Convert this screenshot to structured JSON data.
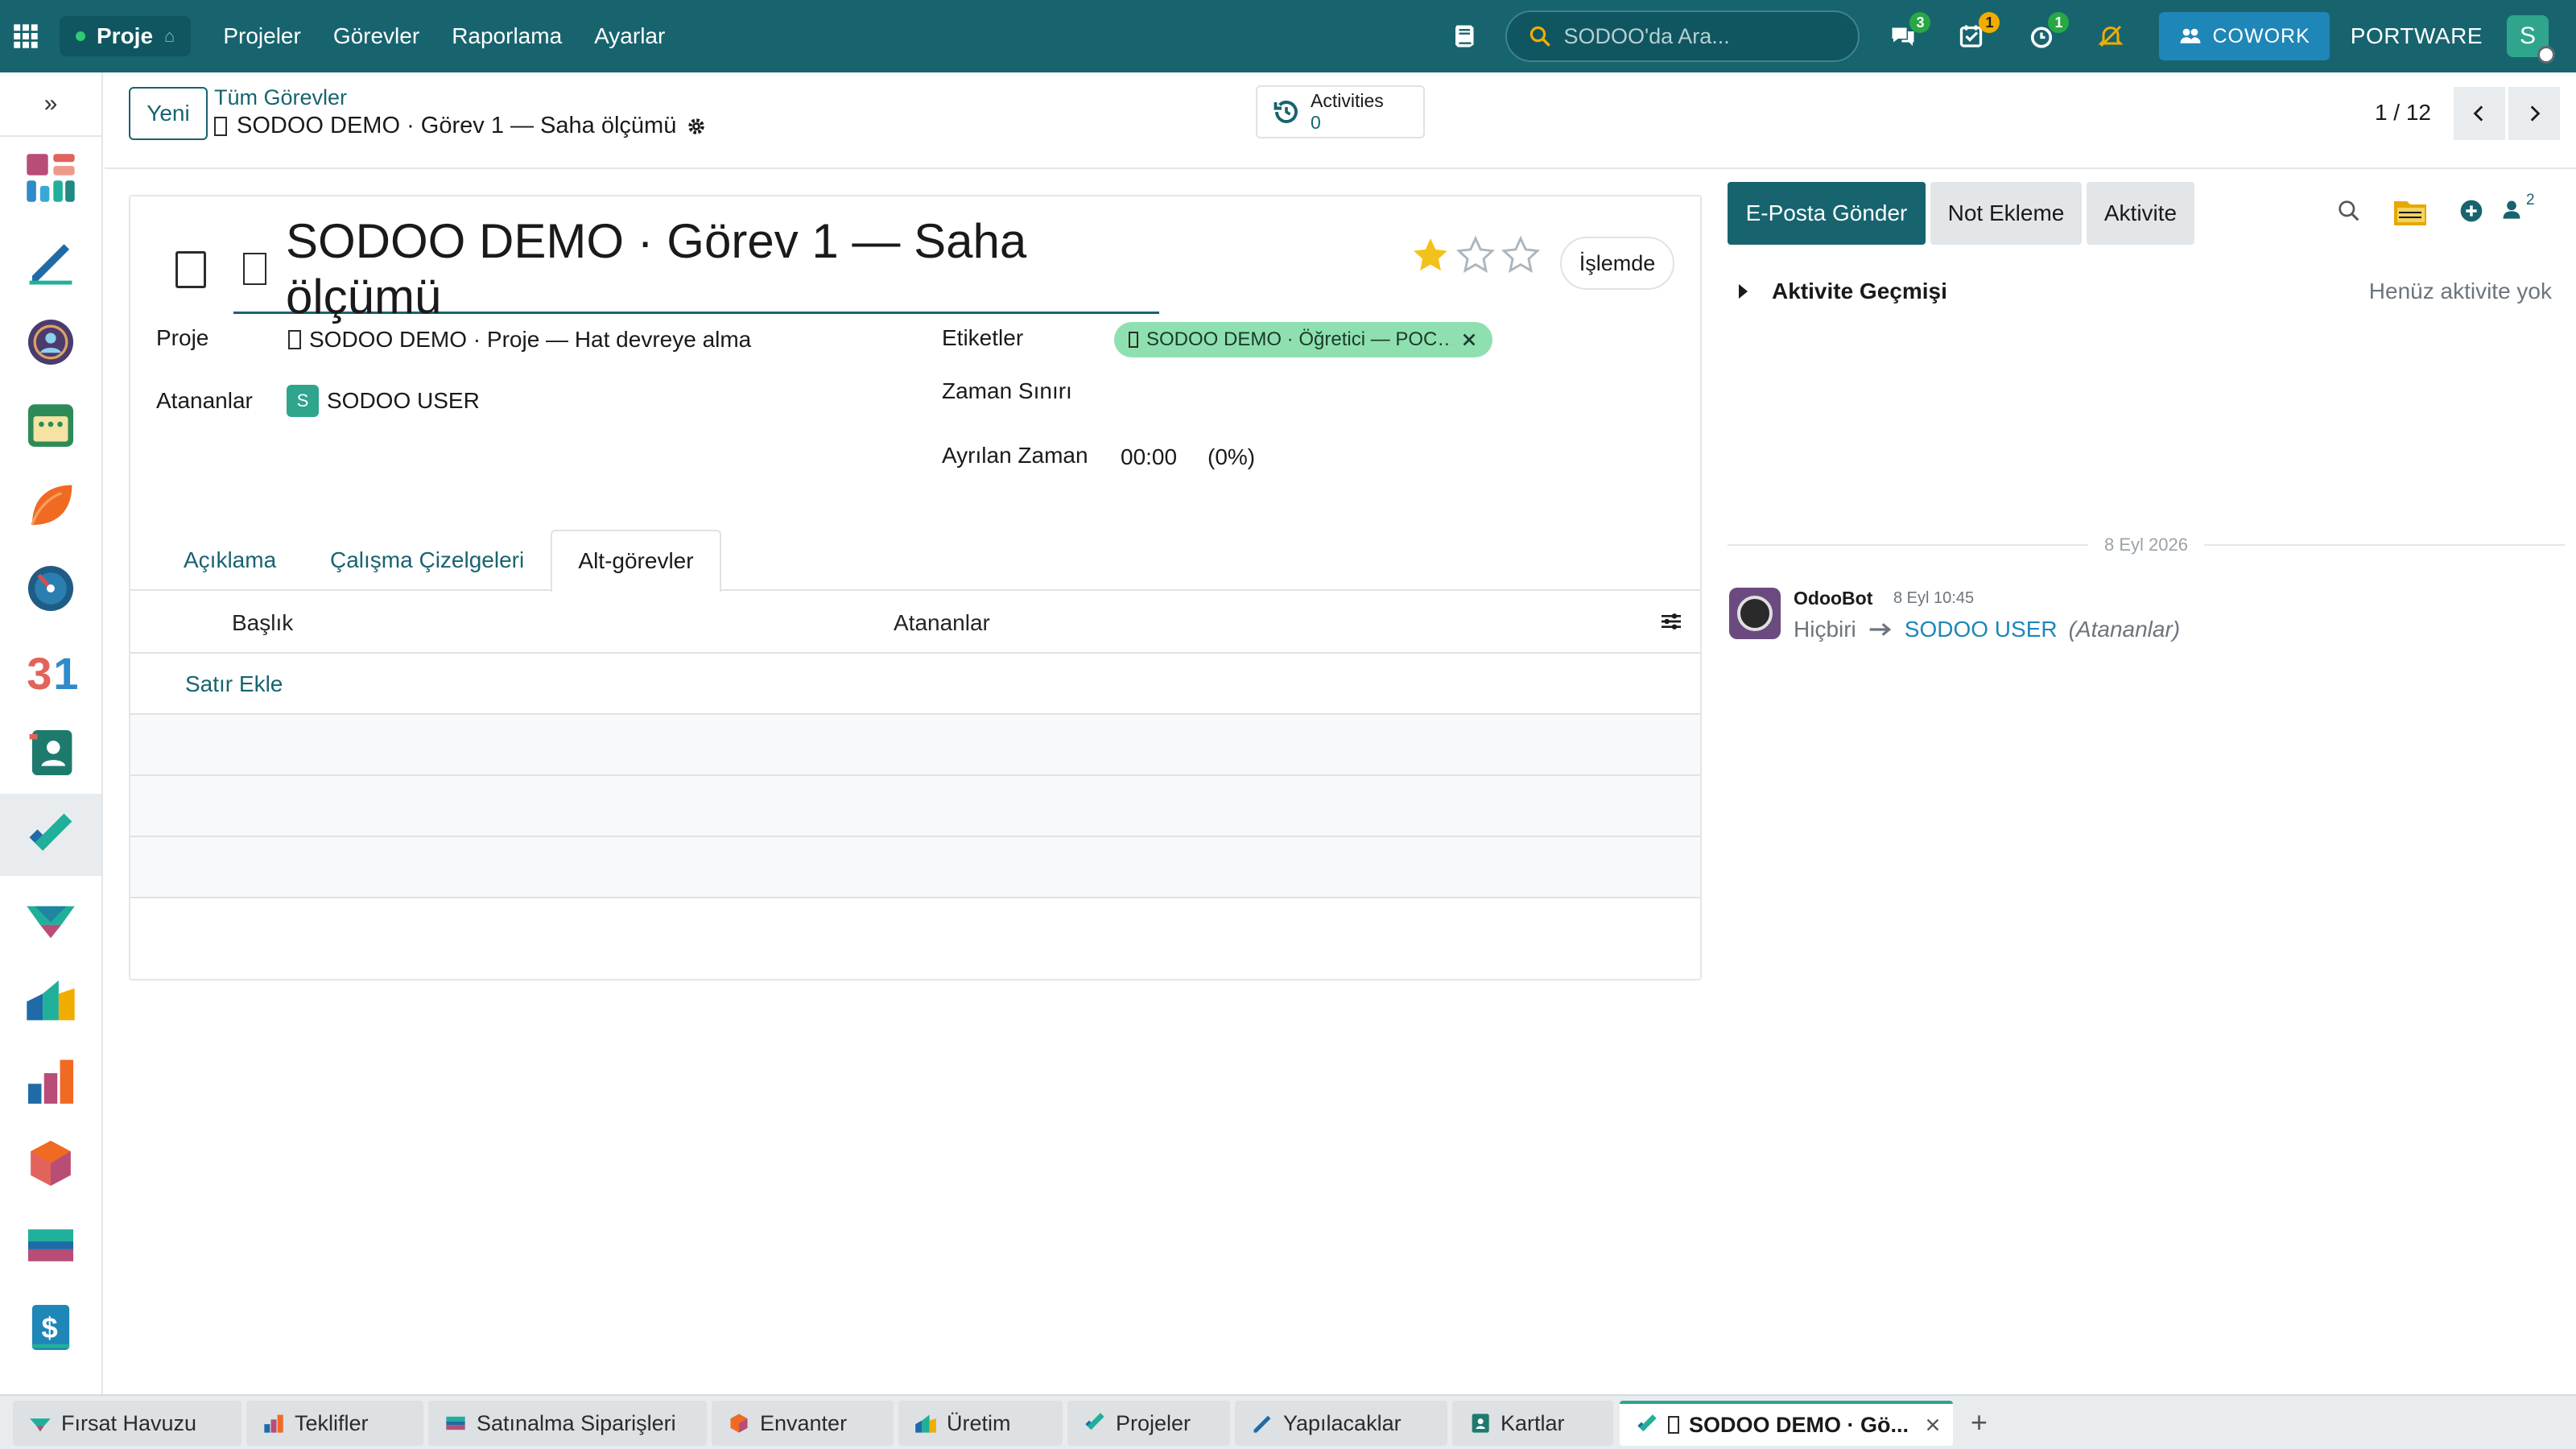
{
  "navbar": {
    "brand": "Proje",
    "menu": [
      "Projeler",
      "Görevler",
      "Raporlama",
      "Ayarlar"
    ],
    "search_placeholder": "SODOO'da Ara...",
    "badges": {
      "messages": "3",
      "activities": "1",
      "timer": "1"
    },
    "cowork_label": "COWORK",
    "company": "PORTWARE",
    "user_initial": "S"
  },
  "sidebar": {
    "apps": [
      "dashboard",
      "todo",
      "discuss",
      "calendar",
      "crm-leaf",
      "timer",
      "calendar-31",
      "contacts",
      "project",
      "sales-funnel",
      "inventory",
      "reporting",
      "product",
      "accounting",
      "invoicing"
    ]
  },
  "control_panel": {
    "new_label": "Yeni",
    "breadcrumb_parent": "Tüm Görevler",
    "breadcrumb_current": "SODOO DEMO · Görev 1 — Saha ölçümü",
    "activities_label": "Activities",
    "activities_count": "0",
    "pager": "1 / 12"
  },
  "task": {
    "title": "SODOO DEMO · Görev 1 — Saha ölçümü",
    "priority_stars": 1,
    "state_label": "İşlemde",
    "fields": {
      "project_label": "Proje",
      "project_value": "SODOO DEMO · Proje — Hat devreye alma",
      "assignees_label": "Atananlar",
      "assignee_initial": "S",
      "assignee_name": "SODOO USER",
      "tags_label": "Etiketler",
      "tag_value": "SODOO DEMO · Öğretici — POC…",
      "deadline_label": "Zaman Sınırı",
      "allocated_label": "Ayrılan Zaman",
      "allocated_value": "00:00",
      "allocated_percent": "(0%)"
    },
    "tabs": [
      "Açıklama",
      "Çalışma Çizelgeleri",
      "Alt-görevler"
    ],
    "active_tab": "Alt-görevler",
    "subtasks": {
      "col_title": "Başlık",
      "col_assignees": "Atananlar",
      "add_line": "Satır Ekle"
    }
  },
  "chatter": {
    "send_email": "E-Posta Gönder",
    "log_note": "Not Ekleme",
    "activity": "Aktivite",
    "follower_count": "2",
    "activity_history": "Aktivite Geçmişi",
    "no_activity": "Henüz aktivite yok",
    "date_separator": "8 Eyl 2026",
    "message": {
      "author": "OdooBot",
      "date": "8 Eyl 10:45",
      "old_value": "Hiçbiri",
      "new_value": "SODOO USER",
      "field": "(Atananlar)"
    }
  },
  "window_tabs": [
    {
      "label": "Fırsat Havuzu",
      "icon": "crm-icon"
    },
    {
      "label": "Teklifler",
      "icon": "sales-icon"
    },
    {
      "label": "Satınalma Siparişleri",
      "icon": "purchase-icon"
    },
    {
      "label": "Envanter",
      "icon": "inventory-icon"
    },
    {
      "label": "Üretim",
      "icon": "manufacturing-icon"
    },
    {
      "label": "Projeler",
      "icon": "project-icon"
    },
    {
      "label": "Yapılacaklar",
      "icon": "todo-icon"
    },
    {
      "label": "Kartlar",
      "icon": "contacts-icon"
    },
    {
      "label": "SODOO DEMO · Gö...",
      "icon": "project-icon"
    }
  ],
  "colors": {
    "navbar": "#17646f",
    "accent": "#17646f",
    "star": "#f3c11b",
    "tag": "#8fe0b0",
    "link": "#1f86b8"
  }
}
